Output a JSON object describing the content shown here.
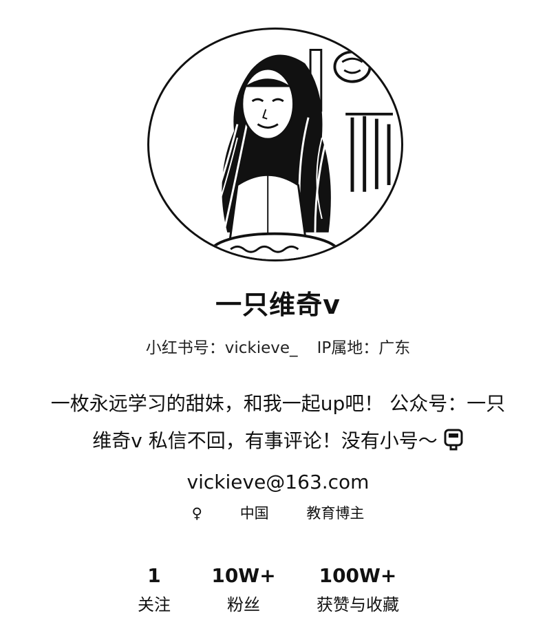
{
  "profile": {
    "nickname": "一只维奇v",
    "red_id": "小红书号：vickieve_",
    "ip_location": "IP属地：广东",
    "bio": {
      "line1": "一枚永远学习的甜妹，和我一起up吧！ 公众号：一只",
      "line2": "维奇v 私信不回，有事评论！没有小号～",
      "line2_icon": "pager-icon",
      "line3": "vickieve@163.com"
    },
    "tags": {
      "gender": "♀",
      "region": "中国",
      "category": "教育博主"
    }
  },
  "stats": [
    {
      "value": "1",
      "label": "关注"
    },
    {
      "value": "10W+",
      "label": "粉丝"
    },
    {
      "value": "100W+",
      "label": "获赞与收藏"
    }
  ]
}
